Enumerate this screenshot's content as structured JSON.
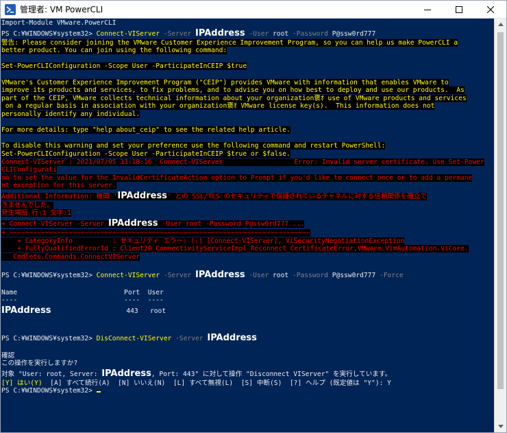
{
  "window": {
    "title": "管理者: VM PowerCLI",
    "controls": {
      "minimize": "—",
      "maximize": "☐",
      "close": "✕"
    }
  },
  "console": {
    "l01": "Import-Module VMware.PowerCLI",
    "prompt": "PS C:¥WINDOWS¥system32> ",
    "connect_cmd": "Connect-VIServer",
    "p_server": " -Server ",
    "ip": "IPAddress",
    "p_user": " -User ",
    "user_val": "root",
    "p_password": " -Password ",
    "pass_val": "P@ssw0rd777",
    "p_force": " -Force",
    "w1": "警告: Please consider joining the VMware Customer Experience Improvement Program, so you can help us make PowerCLI a",
    "w2": "better product. You can join using the following command:",
    "w3": "Set-PowerCLIConfiguration -Scope User -ParticipateInCEIP $true",
    "w4": "VMware's Customer Experience Improvement Program (\"CEIP\") provides VMware with information that enables VMware to",
    "w5": "improve its products and services, to fix problems, and to advise you on how best to deploy and use our products.  As",
    "w6": "part of the CEIP, VMware collects technical information about your organization褒ｵ use of VMware products and services",
    "w7": " on a regular basis in association with your organization褒ｵ VMware license key(s).  This information does not",
    "w8": "personally identify any individual.",
    "w9": "For more details: type \"help about_ceip\" to see the related help article.",
    "w10": "To disable this warning and set your preference use the following command and restart PowerShell:",
    "w11": "Set-PowerCLIConfiguration -Scope User -ParticipateInCEIP $true or $false.",
    "e1a": "Connect-VIServer : 2021/07/05 13:18:16  Connect-VIServer",
    "e1b": "Error: Invalid server certificate. Use Set-Power",
    "e2": "CLIConfigurati",
    "e3": "on to set the value for the InvalidCertificateAction option to Prompt if you'd like to connect once or to add a permane",
    "e4": "nt exception for this server.",
    "e5a": "Additional Information: 機関 '",
    "e5b": "' との SSL/TLS のセキュリティで保護されているチャネルに対する信頼関係を確立で",
    "e6": "きませんでした。",
    "e7": "発生場所 行:1 文字:1",
    "e8a": "+ Connect-VIServer -Server ",
    "e8b": " -User root -Password P@ssw0rd777 ...",
    "e9": "+ ~~~~~~~~~~~~~~~~~~~~~~~~~~~~~~~~~~~~~~~~~~~~~~~~~~~~~~~~~~~~~~~~~~~~~~~~~~~~",
    "e10": "    + CategoryInfo          : セキュリティ エラー: (:) [Connect-VIServer], ViSecurityNegotiationException",
    "e11": "    + FullyQualifiedErrorId : Client20_ConnectivityServiceImpl_Reconnect_CertificateError,VMware.VimAutomation.ViCore.",
    "e12": "   Cmdlets.Commands.ConnectVIServer",
    "table_head": "Name                           Port  User",
    "table_sep": "----                           ----  ----",
    "row_gap": "                   ",
    "row_rest": "443   root",
    "disconnect_cmd": "DisConnect-VIServer",
    "c1": "確認",
    "c2": "この操作を実行しますか?",
    "c3a": "対象 \"User: root, Server: ",
    "c3b": ", Port: 443\" に対して操作 \"Disconnect VIServer\" を実行しています。",
    "c4a": "[Y] はい(Y)",
    "c4b": "  [A] すべて続行(A)  [N] いいえ(N)  [L] すべて無視(L)  [S] 中断(S)  [?] ヘルプ (既定値は \"Y\"): Y"
  }
}
